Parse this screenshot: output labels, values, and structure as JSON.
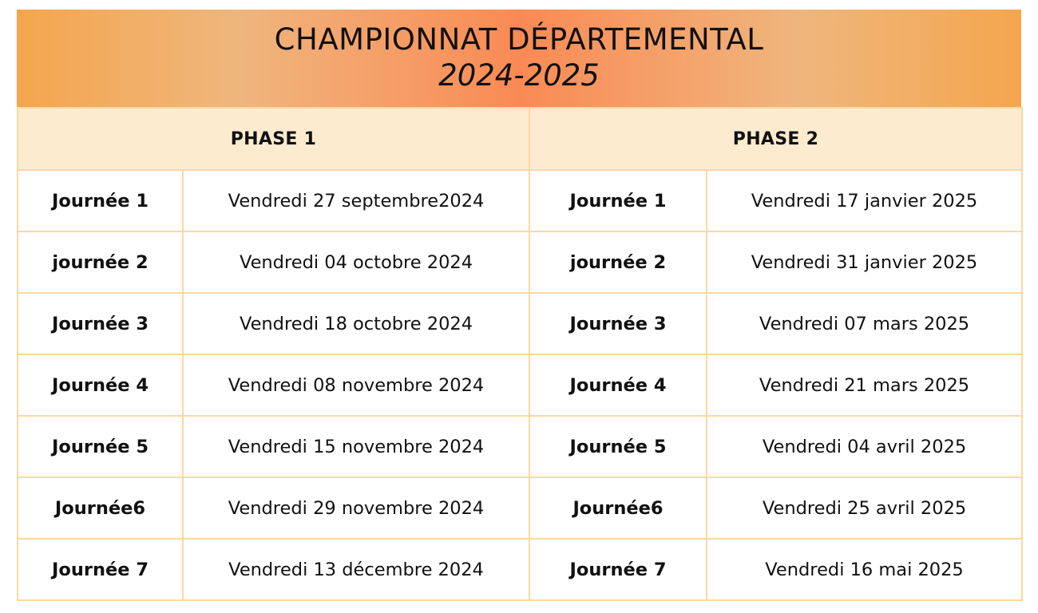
{
  "header": {
    "title": "CHAMPIONNAT DÉPARTEMENTAL",
    "season": "2024-2025"
  },
  "phases": [
    {
      "label": "PHASE 1"
    },
    {
      "label": "PHASE 2"
    }
  ],
  "rows": [
    {
      "p1_day": "Journée 1",
      "p1_date": "Vendredi 27 septembre2024",
      "p2_day": "Journée 1",
      "p2_date": "Vendredi 17 janvier 2025"
    },
    {
      "p1_day": "journée 2",
      "p1_date": "Vendredi 04 octobre 2024",
      "p2_day": "journée 2",
      "p2_date": "Vendredi 31 janvier 2025"
    },
    {
      "p1_day": "Journée 3",
      "p1_date": "Vendredi 18 octobre 2024",
      "p2_day": "Journée 3",
      "p2_date": "Vendredi 07 mars 2025"
    },
    {
      "p1_day": "Journée 4",
      "p1_date": "Vendredi 08 novembre 2024",
      "p2_day": "Journée 4",
      "p2_date": "Vendredi 21 mars 2025"
    },
    {
      "p1_day": "Journée 5",
      "p1_date": "Vendredi 15 novembre 2024",
      "p2_day": "Journée 5",
      "p2_date": "Vendredi 04 avril 2025"
    },
    {
      "p1_day": "Journée6",
      "p1_date": "Vendredi 29 novembre 2024",
      "p2_day": "Journée6",
      "p2_date": "Vendredi 25 avril 2025"
    },
    {
      "p1_day": "Journée 7",
      "p1_date": "Vendredi 13 décembre 2024",
      "p2_day": "Journée 7",
      "p2_date": "Vendredi 16 mai 2025"
    }
  ],
  "colors": {
    "banner_edge": "#f4a64e",
    "banner_center": "#fa8a55",
    "header_row": "#fdebcf",
    "border": "#fcd89e"
  }
}
